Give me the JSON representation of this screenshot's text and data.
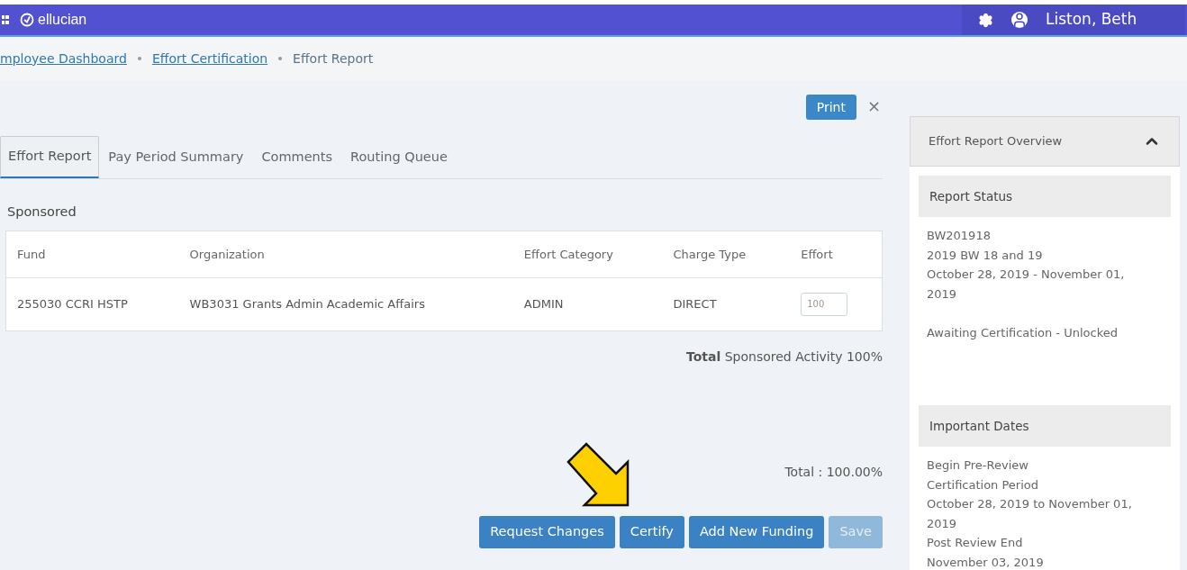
{
  "header": {
    "brand": "ellucian",
    "user_name": "Liston, Beth"
  },
  "breadcrumbs": [
    {
      "label": "mployee Dashboard",
      "link": true
    },
    {
      "label": "Effort Certification",
      "link": true
    },
    {
      "label": "Effort Report",
      "link": false
    }
  ],
  "print_button": "Print",
  "close_icon": "×",
  "tabs": [
    {
      "label": "Effort Report",
      "selected": true
    },
    {
      "label": "Pay Period Summary",
      "selected": false
    },
    {
      "label": "Comments",
      "selected": false
    },
    {
      "label": "Routing Queue",
      "selected": false
    }
  ],
  "section_title": "Sponsored",
  "table": {
    "columns": [
      "Fund",
      "Organization",
      "Effort Category",
      "Charge Type",
      "Effort"
    ],
    "rows": [
      {
        "fund": "255030 CCRI HSTP",
        "organization": "WB3031 Grants Admin Academic Affairs",
        "effort_category": "ADMIN",
        "charge_type": "DIRECT",
        "effort": "100"
      }
    ]
  },
  "sponsored_total": "**Total** Sponsored Activity 100%",
  "grand_total": "Total : 100.00%",
  "actions": [
    {
      "label": "Request Changes",
      "disabled": false
    },
    {
      "label": "Certify",
      "disabled": false
    },
    {
      "label": "Add New Funding",
      "disabled": false
    },
    {
      "label": "Save",
      "disabled": true
    }
  ],
  "overview": {
    "title": "Effort Report Overview",
    "expanded": true,
    "sections": [
      {
        "title": "Report Status",
        "groups": [
          [
            "BW201918",
            "2019 BW 18 and 19",
            "October 28, 2019 - November 01, 2019"
          ],
          [
            "Awaiting Certification - Unlocked"
          ]
        ]
      },
      {
        "title": "Important Dates",
        "groups": [
          [
            "Begin Pre-Review",
            "Certification Period",
            "October 28, 2019 to November 01, 2019",
            "Post Review End",
            "November 03, 2019"
          ]
        ]
      }
    ]
  }
}
